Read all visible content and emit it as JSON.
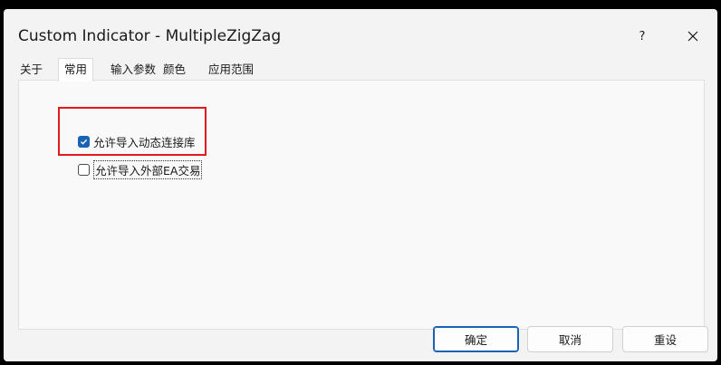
{
  "window": {
    "title": "Custom Indicator - MultipleZigZag",
    "help_label": "?",
    "close_icon": "close-icon"
  },
  "tabs": [
    {
      "label": "关于"
    },
    {
      "label": "常用"
    },
    {
      "label": "输入参数"
    },
    {
      "label": "颜色"
    },
    {
      "label": "应用范围"
    }
  ],
  "active_tab": "常用",
  "options": {
    "allow_dll": {
      "label": "允许导入动态连接库",
      "checked": true
    },
    "allow_ea": {
      "label": "允许导入外部EA交易",
      "checked": false
    }
  },
  "buttons": {
    "ok": "确定",
    "cancel": "取消",
    "reset": "重设"
  },
  "colors": {
    "accent": "#1a62b3",
    "highlight": "#e0191f"
  }
}
